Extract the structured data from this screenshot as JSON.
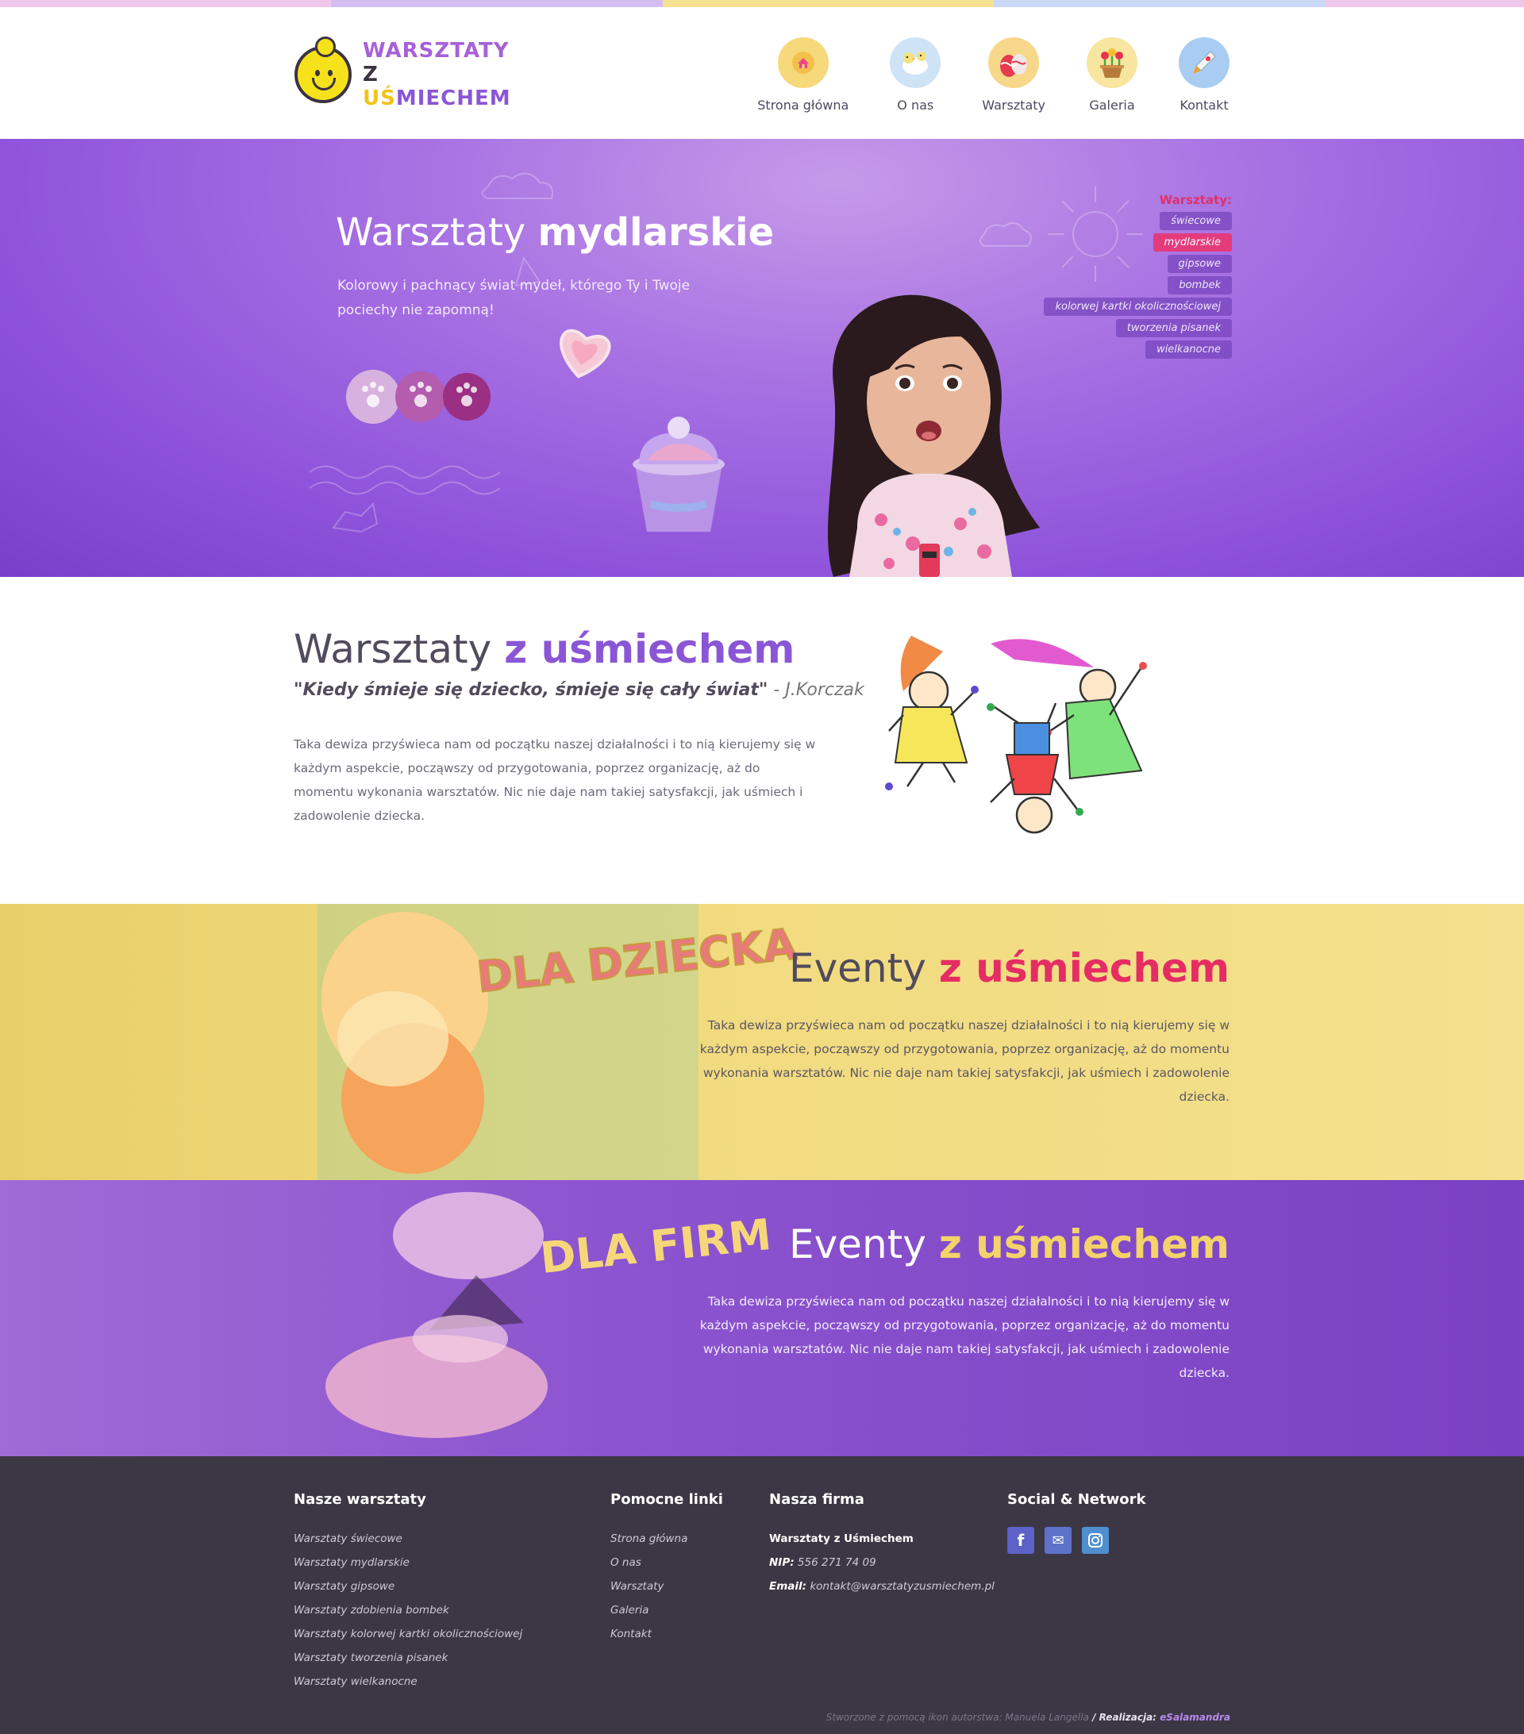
{
  "colors": {
    "accent_purple": "#8a56d6",
    "accent_pink": "#e52d63",
    "accent_yellow": "#f3d36a",
    "footer_bg": "#3c3744"
  },
  "topstripe": [
    "#f0c6ea",
    "#d4bdf2",
    "#f5e391",
    "#c9d8f6",
    "#f0c6ea"
  ],
  "logo": {
    "line1": "WARSZTATY",
    "line2_a": "Z ",
    "line2_b": "UŚ",
    "line2_c": "MIECHEM"
  },
  "nav": [
    {
      "label": "Strona główna",
      "icon": "home-icon",
      "color": "#f6d97a"
    },
    {
      "label": "O nas",
      "icon": "chicks-icon",
      "color": "#cfe3f6"
    },
    {
      "label": "Warsztaty",
      "icon": "easter-eggs-icon",
      "color": "#f7d78a"
    },
    {
      "label": "Galeria",
      "icon": "flower-pot-icon",
      "color": "#f7e5a0"
    },
    {
      "label": "Kontakt",
      "icon": "rocket-icon",
      "color": "#a9cdf2"
    }
  ],
  "hero": {
    "title_light": "Warsztaty ",
    "title_bold": "mydlarskie",
    "subtitle": "Kolorowy i pachnący świat mydeł, którego Ty i Twoje pociechy nie zapomną!",
    "submenu_title": "Warsztaty:",
    "submenu": [
      {
        "label": "świecowe",
        "active": false
      },
      {
        "label": "mydlarskie",
        "active": true
      },
      {
        "label": "gipsowe",
        "active": false
      },
      {
        "label": "bombek",
        "active": false
      },
      {
        "label": "kolorwej kartki okolicznościowej",
        "active": false
      },
      {
        "label": "tworzenia pisanek",
        "active": false
      },
      {
        "label": "wielkanocne",
        "active": false
      }
    ]
  },
  "about": {
    "title_a": "Warsztaty ",
    "title_b": "z uśmiechem",
    "quote": "\"Kiedy śmieje się dziecko, śmieje się cały świat\"",
    "quote_author": " - J.Korczak",
    "text": "Taka dewiza przyświeca nam od początku naszej działalności i to nią kierujemy się w każdym aspekcie, począwszy od przygotowania, poprzez organizację, aż do momentu wykonania warsztatów. Nic nie daje nam takiej satysfakcji, jak uśmiech i zadowolenie dziecka."
  },
  "events": [
    {
      "stamp": "DLA DZIECKA",
      "title_a": "Eventy ",
      "title_b": "z uśmiechem",
      "text": "Taka dewiza przyświeca nam od początku naszej działalności i to nią kierujemy się w każdym aspekcie, począwszy od przygotowania, poprzez organizację, aż do momentu wykonania warsztatów. Nic nie daje nam takiej satysfakcji, jak uśmiech i zadowolenie dziecka."
    },
    {
      "stamp": "DLA FIRM",
      "title_a": "Eventy ",
      "title_b": "z uśmiechem",
      "text": "Taka dewiza przyświeca nam od początku naszej działalności i to nią kierujemy się w każdym aspekcie, począwszy od przygotowania, poprzez organizację, aż do momentu wykonania warsztatów. Nic nie daje nam takiej satysfakcji, jak uśmiech i zadowolenie dziecka."
    }
  ],
  "footer": {
    "col1": {
      "title": "Nasze warsztaty",
      "links": [
        "Warsztaty świecowe",
        "Warsztaty mydlarskie",
        "Warsztaty gipsowe",
        "Warsztaty zdobienia bombek",
        "Warsztaty kolorwej kartki okolicznościowej",
        "Warsztaty tworzenia pisanek",
        "Warsztaty wielkanocne"
      ]
    },
    "col2": {
      "title": "Pomocne linki",
      "links": [
        "Strona główna",
        "O nas",
        "Warsztaty",
        "Galeria",
        "Kontakt"
      ]
    },
    "col3": {
      "title": "Nasza firma",
      "name": "Warsztaty z Uśmiechem",
      "nip_label": "NIP:",
      "nip": " 556 271 74 09",
      "email_label": "Email:",
      "email": " kontakt@warsztatyzusmiechem.pl"
    },
    "col4": {
      "title": "Social & Network",
      "icons": [
        {
          "icon": "facebook-icon",
          "glyph": "f",
          "color": "#5c62c8"
        },
        {
          "icon": "email-icon",
          "glyph": "✉",
          "color": "#5d72c9"
        },
        {
          "icon": "instagram-icon",
          "glyph": "◙",
          "color": "#4f8fd0"
        }
      ]
    },
    "credits_a": "Stworzone z pomocą ikon autorstwa: Manuela Langella",
    "credits_sep": " / ",
    "credits_b": "Realizacja: ",
    "credits_c": "eSalamandra"
  }
}
